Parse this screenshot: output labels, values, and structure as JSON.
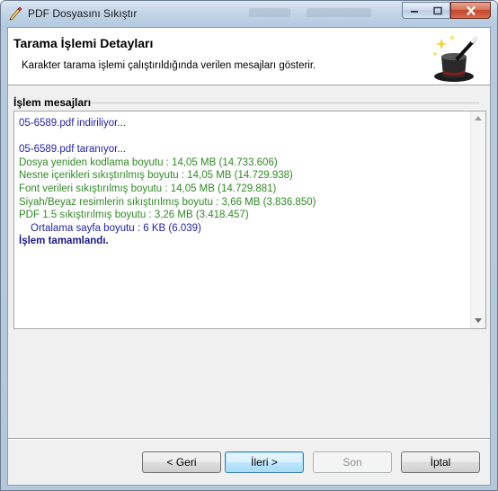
{
  "window": {
    "title": "PDF Dosyasını Sıkıştır",
    "icon": "pdf-compress-app-icon"
  },
  "header": {
    "title": "Tarama İşlemi Detayları",
    "subtitle": "Karakter tarama işlemi çalıştırıldığında verilen mesajları gösterir.",
    "image": "magic-hat-wand-icon"
  },
  "group": {
    "label": "İşlem mesajları"
  },
  "messages": [
    {
      "text": "05-6589.pdf indiriliyor...",
      "color": "#1f1fa8",
      "style": "blue"
    },
    {
      "text": "",
      "style": "blank"
    },
    {
      "text": "05-6589.pdf taranıyor...",
      "color": "#1f1fa8",
      "style": "blue"
    },
    {
      "text": "Dosya yeniden kodlama boyutu : 14,05 MB (14.733.606)",
      "color": "#2f8a24",
      "style": "green"
    },
    {
      "text": "Nesne içerikleri sıkıştırılmış boyutu : 14,05 MB (14.729.938)",
      "color": "#2f8a24",
      "style": "green"
    },
    {
      "text": "Font verileri sıkıştırılmış boyutu : 14,05 MB (14.729.881)",
      "color": "#2f8a24",
      "style": "green"
    },
    {
      "text": "Siyah/Beyaz resimlerin sıkıştırılmış boyutu : 3,66 MB (3.836.850)",
      "color": "#2f8a24",
      "style": "green"
    },
    {
      "text": "PDF 1.5 sıkıştırılmış boyutu : 3,26 MB (3.418.457)",
      "color": "#2f8a24",
      "style": "green"
    },
    {
      "text": "Ortalama sayfa boyutu : 6 KB (6.039)",
      "color": "#1f1fa8",
      "style": "blue-indent"
    },
    {
      "text": "İşlem tamamlandı.",
      "color": "#1a1a8a",
      "style": "bold"
    }
  ],
  "buttons": {
    "back": "< Geri",
    "next": "İleri >",
    "finish": "Son",
    "cancel": "İptal"
  }
}
